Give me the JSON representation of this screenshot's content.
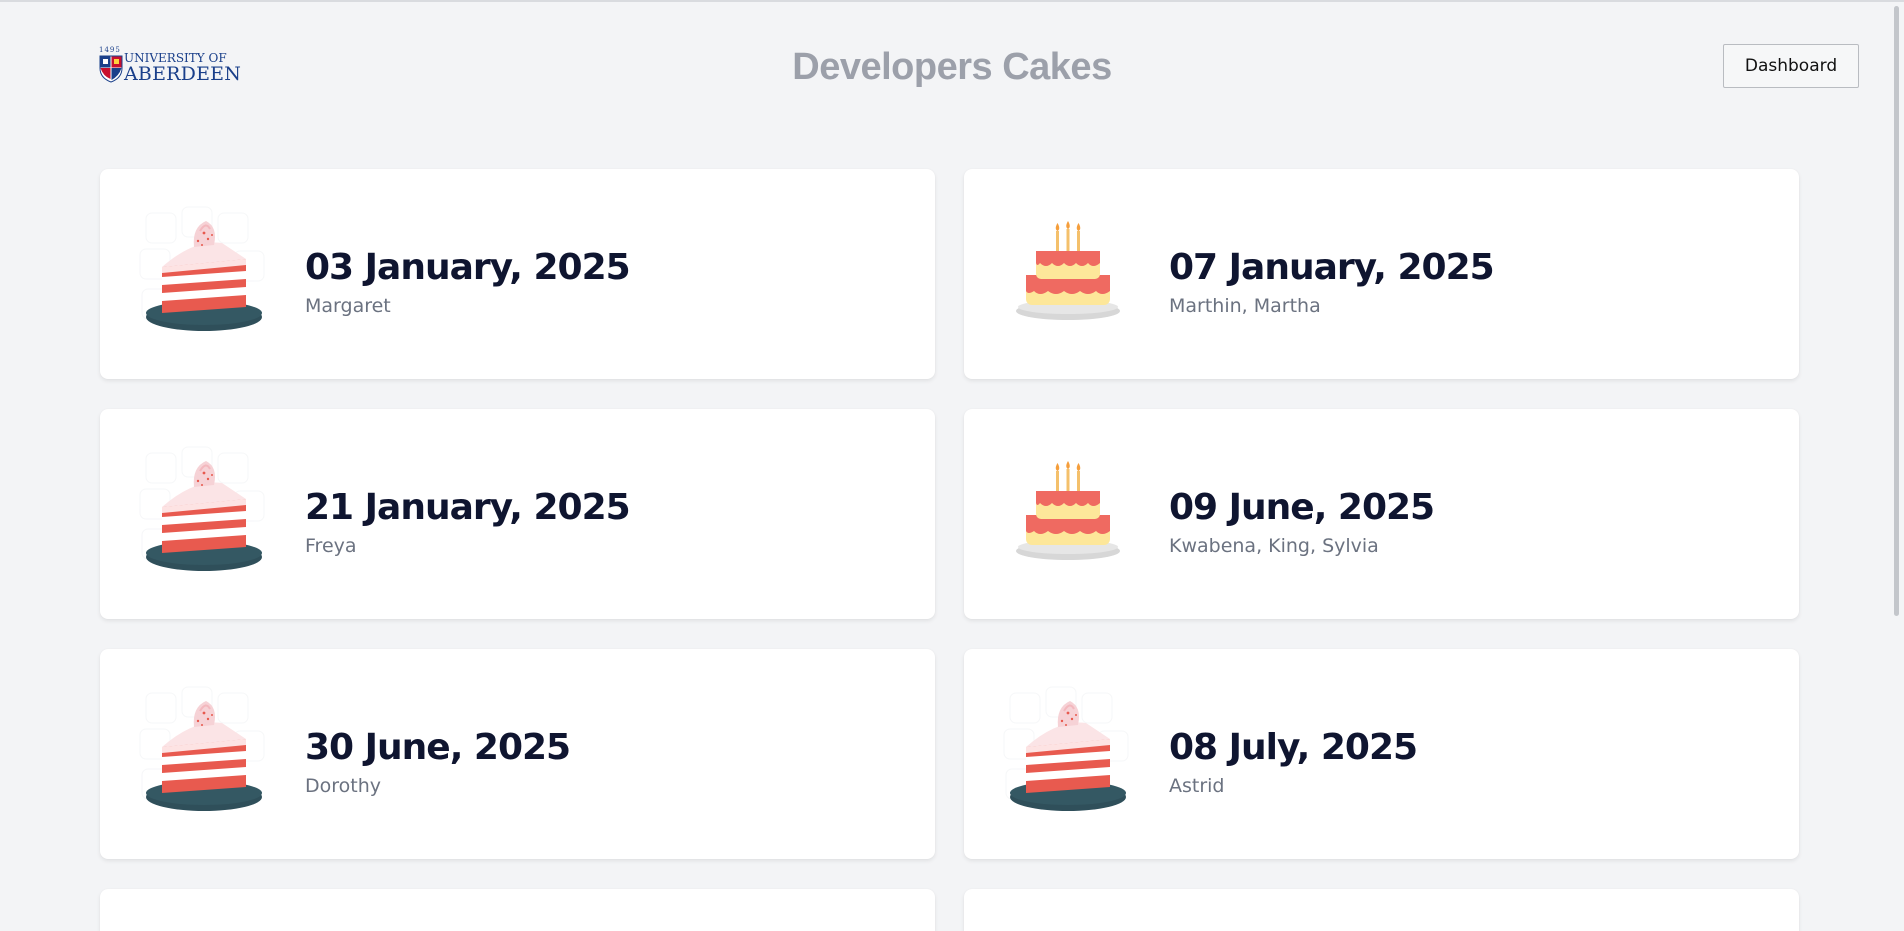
{
  "header": {
    "logo_year": "1495",
    "logo_line1": "UNIVERSITY OF",
    "logo_line2": "ABERDEEN",
    "title": "Developers Cakes",
    "dashboard_label": "Dashboard"
  },
  "cards": [
    {
      "date": "03 January, 2025",
      "names": "Margaret",
      "icon": "cake-slice-icon"
    },
    {
      "date": "07 January, 2025",
      "names": "Marthin, Martha",
      "icon": "birthday-cake-icon"
    },
    {
      "date": "21 January, 2025",
      "names": "Freya",
      "icon": "cake-slice-icon"
    },
    {
      "date": "09 June, 2025",
      "names": "Kwabena, King, Sylvia",
      "icon": "birthday-cake-icon"
    },
    {
      "date": "30 June, 2025",
      "names": "Dorothy",
      "icon": "cake-slice-icon"
    },
    {
      "date": "08 July, 2025",
      "names": "Astrid",
      "icon": "cake-slice-icon"
    }
  ],
  "colors": {
    "background": "#f3f4f6",
    "title": "#9ca0aa",
    "date_text": "#0f1530",
    "names_text": "#6b7280",
    "logo_blue": "#1a3f8a"
  }
}
